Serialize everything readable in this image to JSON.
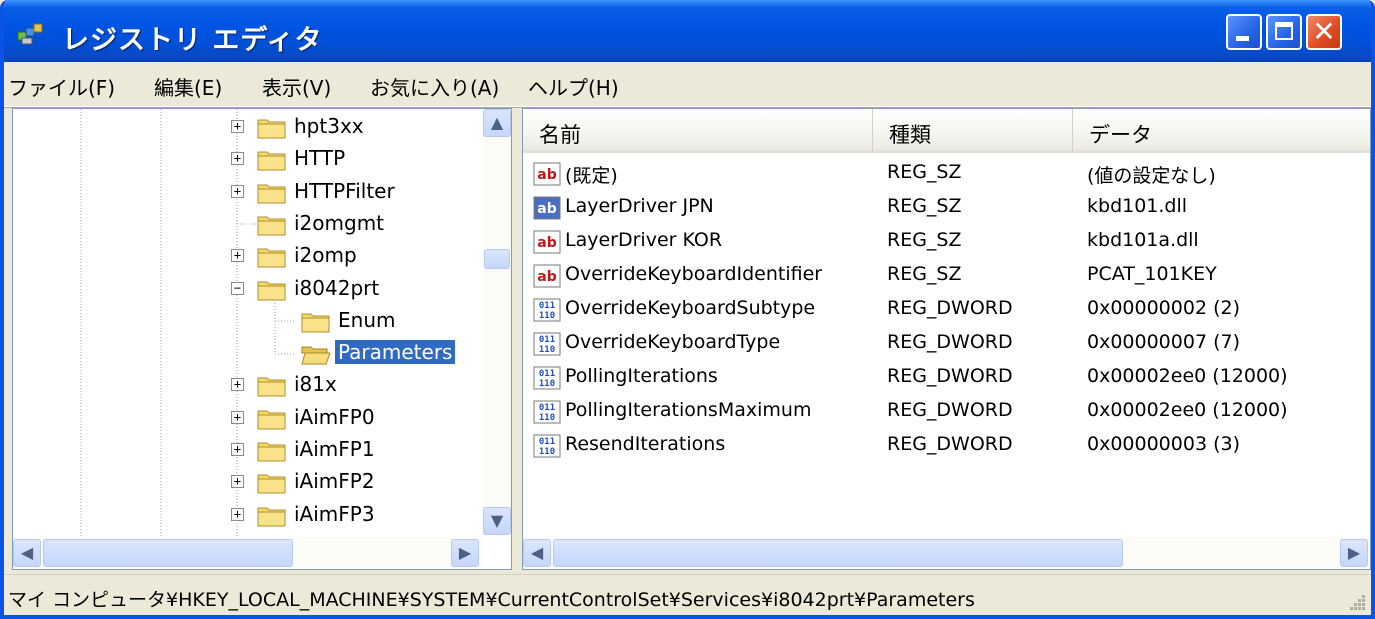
{
  "window": {
    "title": "レジストリ エディタ"
  },
  "menu": [
    "ファイル(F)",
    "編集(E)",
    "表示(V)",
    "お気に入り(A)",
    "ヘルプ(H)"
  ],
  "tree": {
    "items": [
      {
        "label": "hpt3xx",
        "expander": "+"
      },
      {
        "label": "HTTP",
        "expander": "+"
      },
      {
        "label": "HTTPFilter",
        "expander": "+"
      },
      {
        "label": "i2omgmt",
        "expander": ""
      },
      {
        "label": "i2omp",
        "expander": "+"
      },
      {
        "label": "i8042prt",
        "expander": "−"
      },
      {
        "label": "Enum",
        "expander": ""
      },
      {
        "label": "Parameters",
        "expander": "",
        "selected": true
      },
      {
        "label": "i81x",
        "expander": "+"
      },
      {
        "label": "iAimFP0",
        "expander": "+"
      },
      {
        "label": "iAimFP1",
        "expander": "+"
      },
      {
        "label": "iAimFP2",
        "expander": "+"
      },
      {
        "label": "iAimFP3",
        "expander": "+"
      }
    ]
  },
  "list": {
    "columns": [
      "名前",
      "種類",
      "データ"
    ],
    "rows": [
      {
        "icon": "string-value-icon",
        "name": "(既定)",
        "type": "REG_SZ",
        "data": "(値の設定なし)"
      },
      {
        "icon": "string-value-icon",
        "name": "LayerDriver JPN",
        "type": "REG_SZ",
        "data": "kbd101.dll"
      },
      {
        "icon": "string-value-icon",
        "name": "LayerDriver KOR",
        "type": "REG_SZ",
        "data": "kbd101a.dll"
      },
      {
        "icon": "string-value-icon",
        "name": "OverrideKeyboardIdentifier",
        "type": "REG_SZ",
        "data": "PCAT_101KEY"
      },
      {
        "icon": "dword-value-icon",
        "name": "OverrideKeyboardSubtype",
        "type": "REG_DWORD",
        "data": "0x00000002 (2)"
      },
      {
        "icon": "dword-value-icon",
        "name": "OverrideKeyboardType",
        "type": "REG_DWORD",
        "data": "0x00000007 (7)"
      },
      {
        "icon": "dword-value-icon",
        "name": "PollingIterations",
        "type": "REG_DWORD",
        "data": "0x00002ee0 (12000)"
      },
      {
        "icon": "dword-value-icon",
        "name": "PollingIterationsMaximum",
        "type": "REG_DWORD",
        "data": "0x00002ee0 (12000)"
      },
      {
        "icon": "dword-value-icon",
        "name": "ResendIterations",
        "type": "REG_DWORD",
        "data": "0x00000003 (3)"
      }
    ]
  },
  "status": {
    "path": "マイ コンピュータ¥HKEY_LOCAL_MACHINE¥SYSTEM¥CurrentControlSet¥Services¥i8042prt¥Parameters"
  },
  "colors": {
    "titlebar": "#0054e3",
    "selection": "#316ac5",
    "close_button": "#e04a20",
    "folder": "#f5d96b"
  }
}
